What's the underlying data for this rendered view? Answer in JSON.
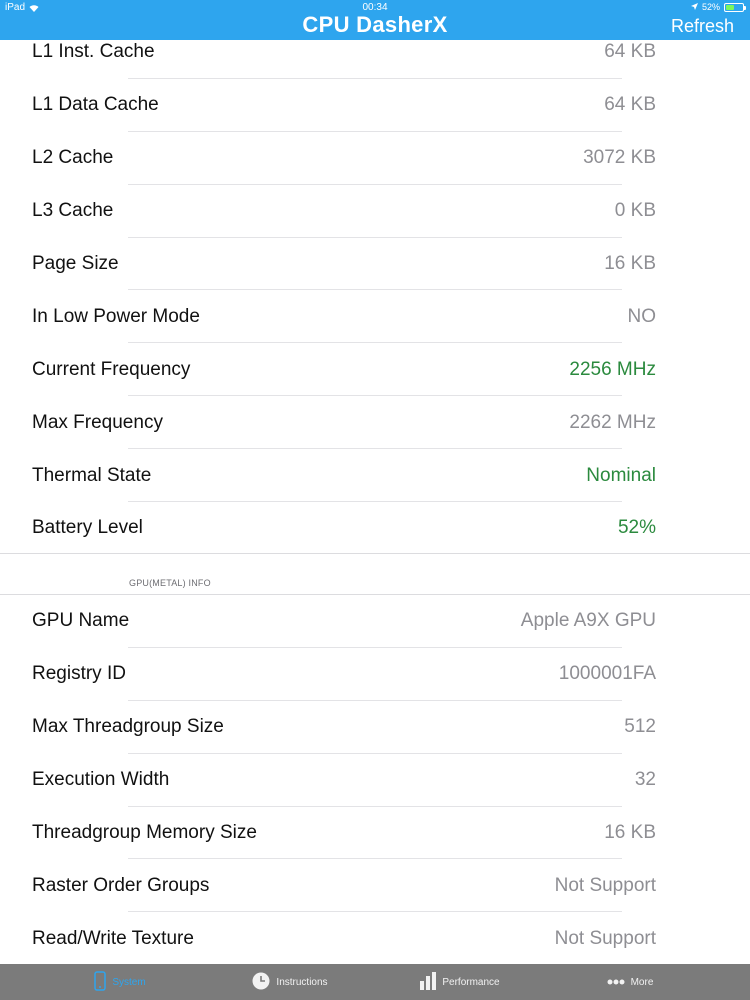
{
  "status_bar": {
    "device": "iPad",
    "time": "00:34",
    "battery_percent": "52%",
    "battery_level": 0.52
  },
  "header": {
    "title": "CPU DasherX",
    "refresh_label": "Refresh"
  },
  "cpu_rows": [
    {
      "label": "L1 Inst. Cache",
      "value": "64 KB"
    },
    {
      "label": "L1 Data Cache",
      "value": "64 KB"
    },
    {
      "label": "L2 Cache",
      "value": "3072 KB"
    },
    {
      "label": "L3 Cache",
      "value": "0 KB"
    },
    {
      "label": "Page Size",
      "value": "16 KB"
    },
    {
      "label": "In Low Power Mode",
      "value": "NO"
    },
    {
      "label": "Current Frequency",
      "value": "2256 MHz"
    },
    {
      "label": "Max Frequency",
      "value": "2262 MHz"
    },
    {
      "label": "Thermal State",
      "value": "Nominal"
    },
    {
      "label": "Battery Level",
      "value": "52%"
    }
  ],
  "gpu_section": {
    "header": "GPU(METAL) INFO",
    "rows": [
      {
        "label": "GPU Name",
        "value": "Apple A9X GPU"
      },
      {
        "label": "Registry ID",
        "value": "1000001FA"
      },
      {
        "label": "Max Threadgroup Size",
        "value": "512"
      },
      {
        "label": "Execution Width",
        "value": "32"
      },
      {
        "label": "Threadgroup Memory Size",
        "value": "16 KB"
      },
      {
        "label": "Raster Order Groups",
        "value": "Not Support"
      },
      {
        "label": "Read/Write Texture",
        "value": "Not Support"
      }
    ]
  },
  "colors": {
    "header_bg": "#2ea5ee",
    "highlight_value": "#2b8a3e",
    "muted_value": "#8e8e93",
    "tabbar_bg": "#7b7b7b"
  },
  "tabbar": {
    "tabs": [
      {
        "label": "System",
        "icon": "device-icon",
        "active": true
      },
      {
        "label": "Instructions",
        "icon": "clock-icon",
        "active": false
      },
      {
        "label": "Performance",
        "icon": "bar-chart-icon",
        "active": false
      },
      {
        "label": "More",
        "icon": "more-dots-icon",
        "active": false
      }
    ]
  }
}
